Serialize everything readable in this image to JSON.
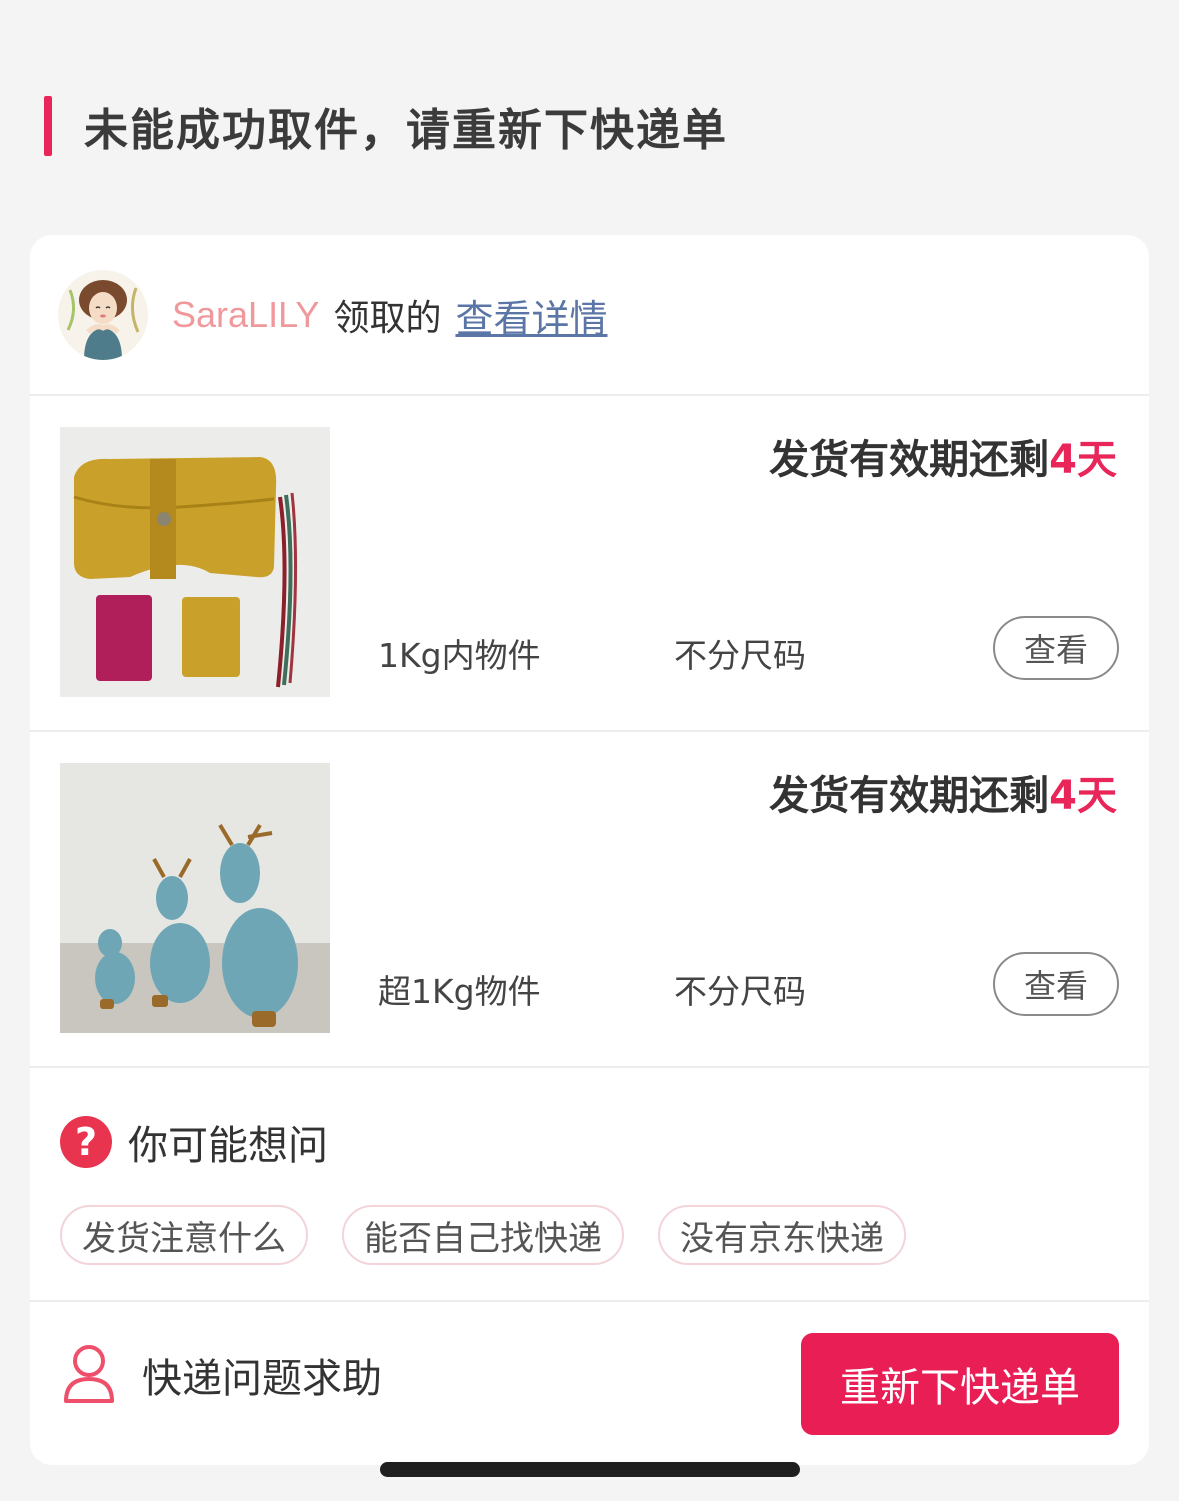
{
  "section_title": "未能成功取件，请重新下快递单",
  "claimer": {
    "name": "SaraLILY",
    "verb": "领取的",
    "details_link": "查看详情"
  },
  "items": [
    {
      "validity_prefix": "发货有效期还剩",
      "validity_days": "4天",
      "weight": "1Kg内物件",
      "size": "不分尺码",
      "view_label": "查看",
      "thumb_icon": "leather-wallet-photo"
    },
    {
      "validity_prefix": "发货有效期还剩",
      "validity_days": "4天",
      "weight": "超1Kg物件",
      "size": "不分尺码",
      "view_label": "查看",
      "thumb_icon": "blue-deer-figurines-photo"
    }
  ],
  "faq": {
    "title": "你可能想问",
    "icon": "question-icon",
    "chips": [
      "发货注意什么",
      "能否自己找快递",
      "没有京东快递"
    ]
  },
  "footer": {
    "help_label": "快递问题求助",
    "help_icon": "person-icon",
    "reorder_label": "重新下快递单"
  },
  "colors": {
    "accent": "#e8265a",
    "button": "#e91e55",
    "name": "#f0999c",
    "link": "#5b76a6"
  }
}
